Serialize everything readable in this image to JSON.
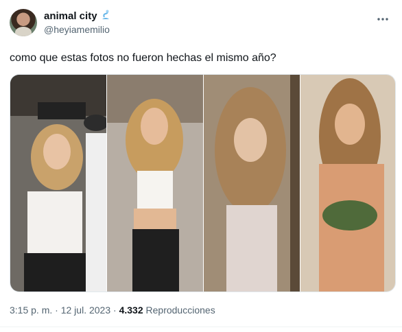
{
  "tweet": {
    "author_name": "animal city",
    "author_handle": "@heyiamemilio",
    "text": "como que estas fotos no fueron hechas el mismo año?",
    "time": "3:15 p. m.",
    "separator": "·",
    "date": "12 jul. 2023",
    "views_count": "4.332",
    "views_label": "Reproducciones"
  },
  "icons": {
    "author_emoji": "genie-emoji-icon",
    "more": "more-horizontal-icon"
  },
  "colors": {
    "text_primary": "#0f1419",
    "text_secondary": "#536471",
    "border": "#e1e8ed"
  }
}
